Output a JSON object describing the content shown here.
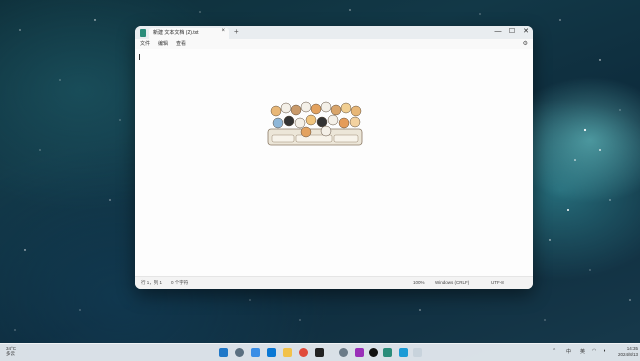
{
  "window": {
    "tab_title": "新建 文本文档 (2).txt",
    "close_tab": "×",
    "new_tab": "+",
    "minimize": "—",
    "maximize": "☐",
    "close": "✕"
  },
  "menu": {
    "items": [
      "文件",
      "编辑",
      "查看"
    ],
    "settings_icon": "gear-icon"
  },
  "status": {
    "position": "行 1，列 1",
    "chars": "0 个字符",
    "zoom": "100%",
    "line_ending": "Windows (CRLF)",
    "encoding": "UTF-8"
  },
  "taskbar": {
    "weather_temp": "34°C",
    "weather_text": "多云",
    "time": "14:35",
    "date": "2024/8/13",
    "apps": [
      "start",
      "search",
      "task-view",
      "vscode",
      "file-explorer",
      "chrome",
      "qq",
      "settings",
      "obs",
      "github",
      "notepad",
      "store"
    ]
  },
  "colors": {
    "accent": "#2a8c7a",
    "taskbar": "#e8eef3"
  }
}
